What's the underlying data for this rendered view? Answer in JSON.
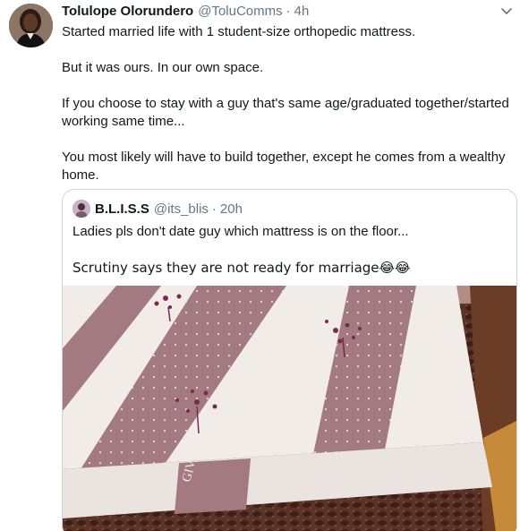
{
  "tweet": {
    "author": {
      "display_name": "Tolulope Olorundero",
      "handle": "@ToluComms",
      "time": "4h",
      "separator": "·",
      "avatar_icon": "profile-photo"
    },
    "paragraphs": [
      "Started married life with 1 student-size orthopedic mattress.",
      "But it was ours. In our own space.",
      "If you choose to stay with a guy that's same age/graduated together/started working same time...",
      "You most likely will have to build together, except he comes from a wealthy home."
    ],
    "menu_icon": "chevron-down-icon"
  },
  "quote": {
    "author": {
      "display_name": "B.L.I.S.S",
      "handle": "@its_blis",
      "time": "20h",
      "separator": "·"
    },
    "paragraphs": [
      "Ladies pls don't date guy which mattress is on the floor...",
      "Scrutiny says they are not ready for marriage😂😂"
    ],
    "image_label": "GIVE"
  },
  "colors": {
    "text": "#14171a",
    "secondary": "#657786",
    "border": "#ccd6dd"
  }
}
